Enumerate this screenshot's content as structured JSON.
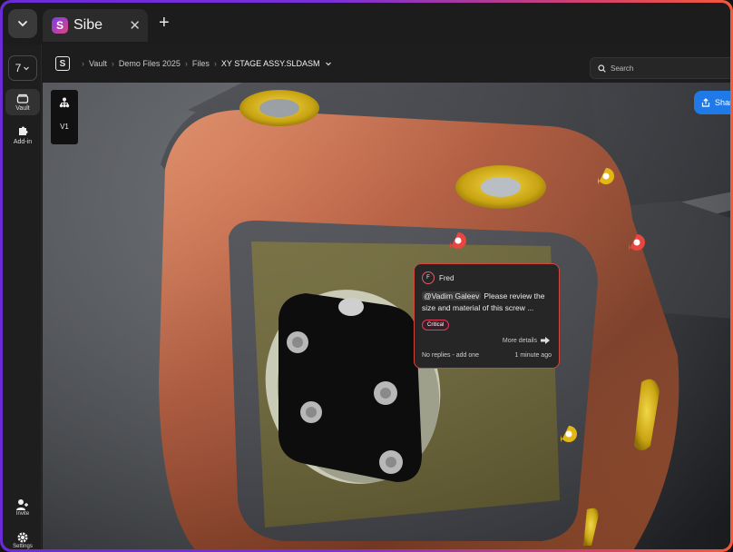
{
  "tabbar": {
    "tab_title": "Sibe",
    "close_glyph": "✕",
    "new_tab_glyph": "+"
  },
  "sidebar": {
    "version_label": "7",
    "items": [
      {
        "label": "Vault",
        "icon": "vault-icon"
      },
      {
        "label": "Add-in",
        "icon": "puzzle-icon"
      }
    ],
    "bottom_items": [
      {
        "label": "Invite",
        "icon": "invite-user-icon"
      },
      {
        "label": "Settings",
        "icon": "gear-icon"
      }
    ]
  },
  "appbar": {
    "breadcrumb": [
      "Vault",
      "Demo Files 2025",
      "Files",
      "XY STAGE ASSY.SLDASM"
    ],
    "search_placeholder": "Search"
  },
  "viewport": {
    "tree_version": "V1",
    "share_label": "Share"
  },
  "comment": {
    "avatar_initial": "F",
    "author": "Fred",
    "mention": "@Vadim Galeev",
    "text": "Please review the size and material of this screw ...",
    "badge": "Critical",
    "more_details": "More details",
    "replies": "No replies - add one",
    "time": "1 minute ago"
  },
  "colors": {
    "accent_blue": "#1f7ae8",
    "critical_red": "#e23b5c",
    "pin_red": "#e8463e",
    "pin_yellow": "#e2b714",
    "frame_gradient_start": "#6a2bd6",
    "frame_gradient_end": "#f15a3a"
  }
}
